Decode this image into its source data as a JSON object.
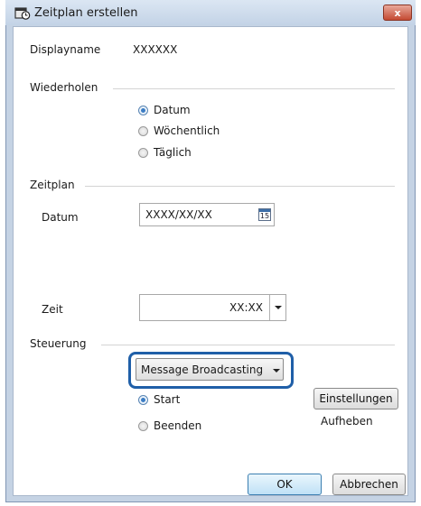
{
  "window": {
    "title": "Zeitplan erstellen",
    "close_label": "x"
  },
  "display": {
    "label": "Displayname",
    "value": "XXXXXX"
  },
  "repeat": {
    "group_label": "Wiederholen",
    "options": [
      "Datum",
      "Wöchentlich",
      "Täglich"
    ],
    "selected": "Datum"
  },
  "schedule": {
    "group_label": "Zeitplan",
    "date_label": "Datum",
    "date_value": "XXXX/XX/XX",
    "calendar_icon_text": "15",
    "time_label": "Zeit",
    "time_value": "XX:XX"
  },
  "control": {
    "group_label": "Steuerung",
    "dropdown_value": "Message Broadcasting",
    "options": [
      "Start",
      "Beenden"
    ],
    "selected": "Start",
    "settings_button": "Einstellungen",
    "cancel_settings_label": "Aufheben"
  },
  "footer": {
    "ok_label": "OK",
    "cancel_label": "Abbrechen"
  }
}
